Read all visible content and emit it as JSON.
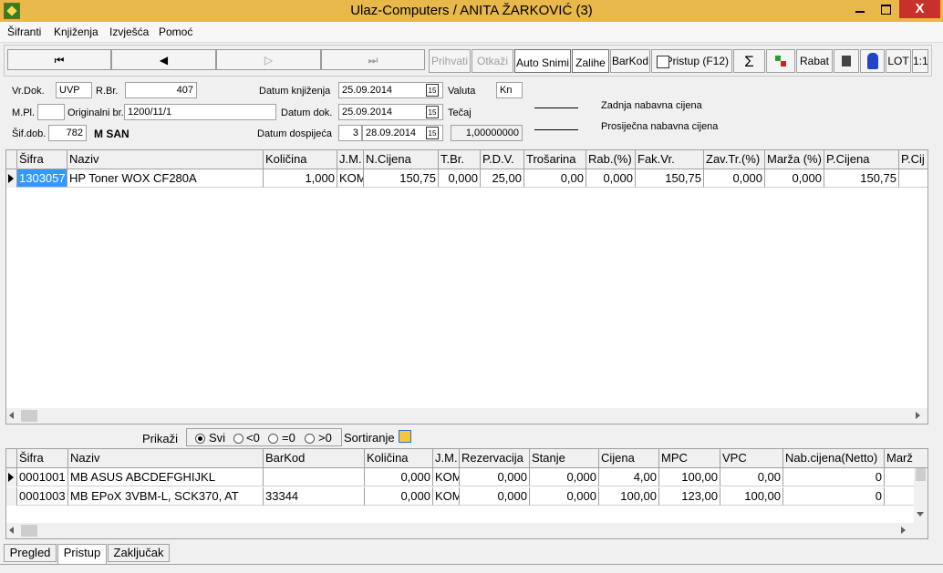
{
  "window": {
    "title": "Ulaz-Computers / ANITA ŽARKOVIĆ (3)",
    "close_label": "X"
  },
  "menu": [
    "Šifranti",
    "Knjiženja",
    "Izvješća",
    "Pomoć"
  ],
  "toolbar": {
    "first": "⏮",
    "prev": "◀",
    "next": "▷",
    "last": "⏭",
    "prihvati": "Prihvati",
    "otkazi": "Otkaži",
    "auto_snimi": "Auto Snimi",
    "zalihe": "Zalihe",
    "barkod": "BarKod",
    "pristup": "Pristup (F12)",
    "sum": "Σ",
    "rabat": "Rabat",
    "lot": "LOT",
    "ratio": "1:1"
  },
  "form": {
    "vr_dok_label": "Vr.Dok.",
    "vr_dok": "UVP",
    "rbr_label": "R.Br.",
    "rbr": "407",
    "mpl_label": "M.Pl.",
    "mpl": "",
    "orig_label": "Originalni br.",
    "orig": "1200/11/1",
    "sif_dob_label": "Šif.dob.",
    "sif_dob": "782",
    "dobavljac": "M SAN",
    "datum_knj_label": "Datum knjiženja",
    "datum_knj": "25.09.2014",
    "datum_dok_label": "Datum dok.",
    "datum_dok": "25.09.2014",
    "datum_dosp_label": "Datum dospijeća",
    "dosp_dani": "3",
    "datum_dosp": "28.09.2014",
    "valuta_label": "Valuta",
    "valuta": "Kn",
    "tecaj_label": "Tečaj",
    "tecaj": "1,00000000",
    "cal_glyph": "15",
    "zadnja_label": "Zadnja nabavna cijena",
    "prosjecna_label": "Prosiječna nabavna cijena"
  },
  "grid1": {
    "headers": [
      "Šifra",
      "Naziv",
      "Količina",
      "J.M.",
      "N.Cijena",
      "T.Br.",
      "P.D.V.",
      "Trošarina",
      "Rab.(%)",
      "Fak.Vr.",
      "Zav.Tr.(%)",
      "Marža (%)",
      "P.Cijena",
      "P.Cij"
    ],
    "rows": [
      [
        "1303057",
        "HP Toner WOX CF280A",
        "1,000",
        "KOM",
        "150,75",
        "0,000",
        "25,00",
        "0,00",
        "0,000",
        "150,75",
        "0,000",
        "0,000",
        "150,75",
        ""
      ]
    ]
  },
  "prikazi": {
    "label": "Prikaži",
    "svi": "Svi",
    "lt0": "<0",
    "eq0": "=0",
    "gt0": ">0",
    "sortiranje": "Sortiranje"
  },
  "grid2": {
    "headers": [
      "Šifra",
      "Naziv",
      "BarKod",
      "Količina",
      "J.M.",
      "Rezervacija",
      "Stanje",
      "Cijena",
      "MPC",
      "VPC",
      "Nab.cijena(Netto)",
      "Marž"
    ],
    "rows": [
      [
        "0001001",
        "MB ASUS ABCDEFGHIJKL",
        "",
        "0,000",
        "KOM",
        "0,000",
        "0,000",
        "4,00",
        "100,00",
        "0,00",
        "0",
        ""
      ],
      [
        "0001003",
        "MB EPoX 3VBM-L, SCK370, AT",
        "33344",
        "0,000",
        "KOM",
        "0,000",
        "0,000",
        "100,00",
        "123,00",
        "100,00",
        "0",
        ""
      ]
    ]
  },
  "tabs": [
    "Pregled",
    "Pristup",
    "Zaključak"
  ]
}
